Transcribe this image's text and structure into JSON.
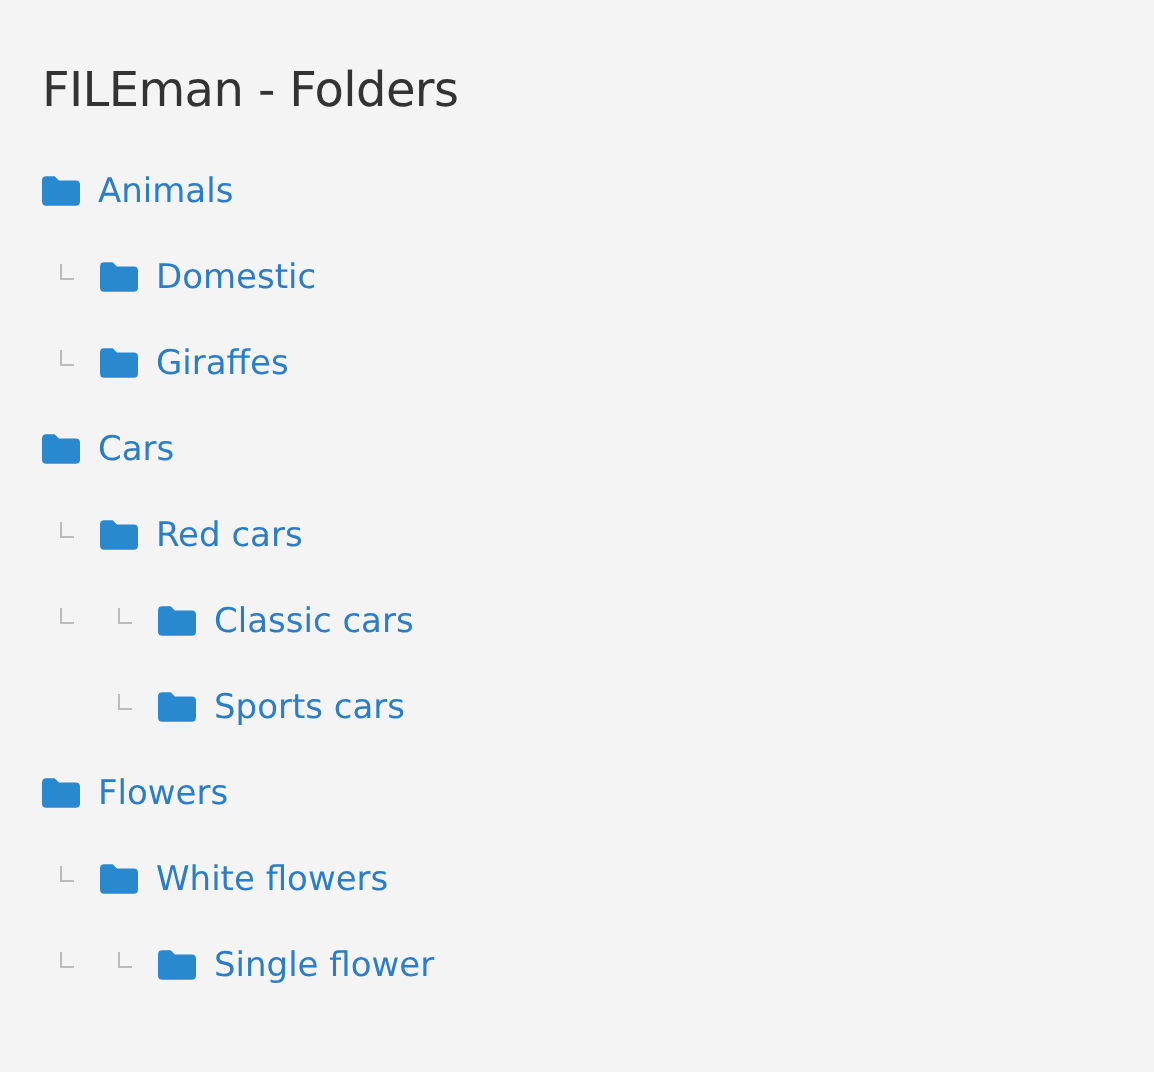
{
  "title": "FILEman - Folders",
  "folders": [
    {
      "name": "Animals",
      "children": [
        {
          "name": "Domestic"
        },
        {
          "name": "Giraffes"
        }
      ]
    },
    {
      "name": "Cars",
      "children": [
        {
          "name": "Red cars",
          "children": [
            {
              "name": "Classic cars",
              "outer_branch": true
            },
            {
              "name": "Sports cars",
              "outer_branch": false
            }
          ]
        }
      ]
    },
    {
      "name": "Flowers",
      "children": [
        {
          "name": "White flowers",
          "children": [
            {
              "name": "Single flower",
              "outer_branch": true
            }
          ]
        }
      ]
    }
  ]
}
